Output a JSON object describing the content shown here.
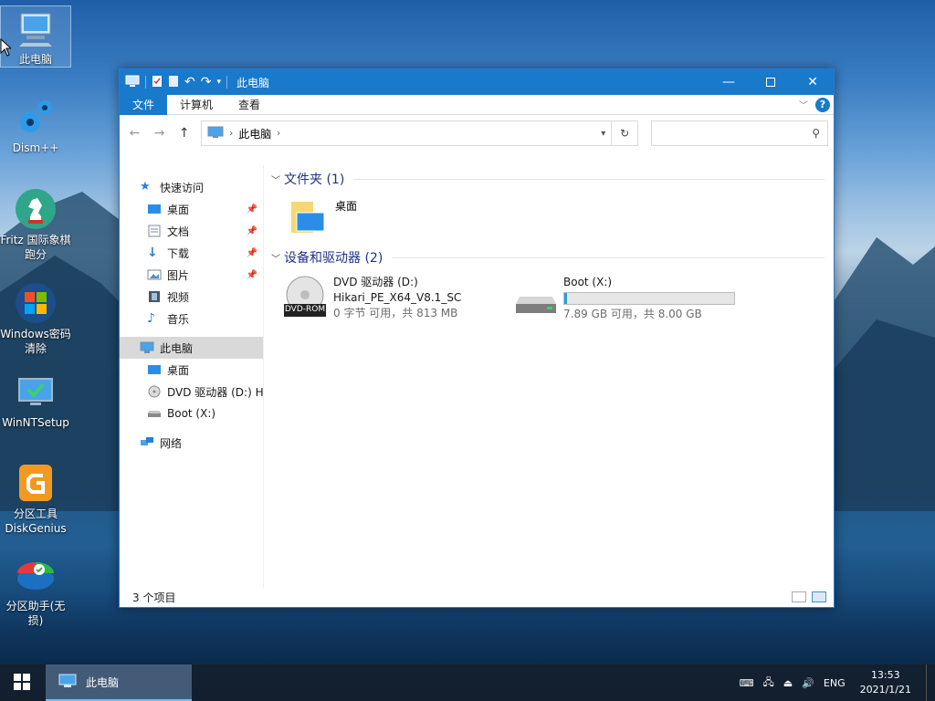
{
  "desktop": {
    "icons": [
      {
        "label": "此电脑",
        "icon": "computer-icon"
      },
      {
        "label": "Dism++",
        "icon": "gears-icon"
      },
      {
        "label": "Fritz 国际象棋跑分",
        "icon": "chess-knight-icon"
      },
      {
        "label": "Windows密码清除",
        "icon": "windows-logo-icon"
      },
      {
        "label": "WinNTSetup",
        "icon": "monitor-check-icon"
      },
      {
        "label": "分区工具DiskGenius",
        "icon": "diskgenius-icon"
      },
      {
        "label": "分区助手(无损)",
        "icon": "partition-assistant-icon"
      }
    ]
  },
  "window": {
    "title": "此电脑",
    "tabs": {
      "file": "文件",
      "computer": "计算机",
      "view": "查看"
    },
    "address": "此电脑",
    "search_placeholder": "",
    "nav": {
      "quick_access": "快速访问",
      "desktop": "桌面",
      "documents": "文档",
      "downloads": "下载",
      "pictures": "图片",
      "videos": "视频",
      "music": "音乐",
      "this_pc": "此电脑",
      "pc_desktop": "桌面",
      "dvd": "DVD 驱动器 (D:) H",
      "boot": "Boot (X:)",
      "network": "网络"
    },
    "groups": {
      "folders": "文件夹 (1)",
      "devices": "设备和驱动器 (2)"
    },
    "folder": {
      "name": "桌面"
    },
    "dvd": {
      "name": "DVD 驱动器 (D:)",
      "label": "Hikari_PE_X64_V8.1_SC",
      "info": "0 字节 可用，共 813 MB",
      "badge": "DVD-ROM"
    },
    "boot": {
      "name": "Boot (X:)",
      "info": "7.89 GB 可用，共 8.00 GB",
      "used_fraction": 0.014
    },
    "status": "3 个项目"
  },
  "taskbar": {
    "task": "此电脑",
    "lang": "ENG",
    "time": "13:53",
    "date": "2021/1/21"
  },
  "colors": {
    "accent": "#1979ca",
    "drive_bar": "#26a0da"
  }
}
